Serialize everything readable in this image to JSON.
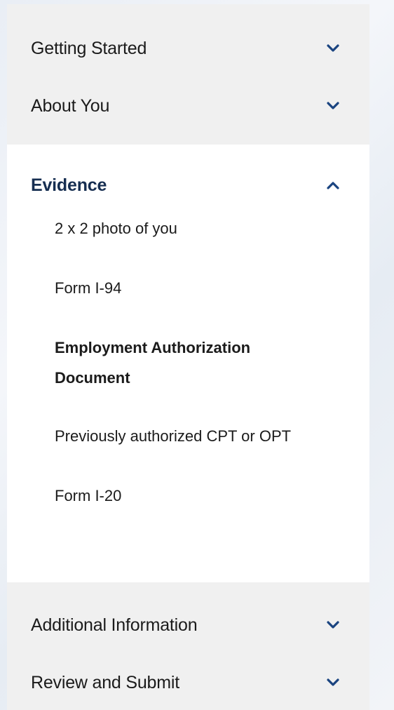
{
  "nav": {
    "sections_top": [
      {
        "label": "Getting Started",
        "icon": "chevron-down-icon"
      },
      {
        "label": "About You",
        "icon": "chevron-down-icon"
      }
    ],
    "evidence": {
      "label": "Evidence",
      "icon": "chevron-up-icon",
      "items": [
        {
          "label": "2 x 2 photo of you"
        },
        {
          "label": "Form I-94"
        },
        {
          "label": "Employment Authorization Document",
          "current": true
        },
        {
          "label": "Previously authorized CPT or OPT"
        },
        {
          "label": "Form I-20"
        }
      ]
    },
    "sections_bottom": [
      {
        "label": "Additional Information",
        "icon": "chevron-down-icon"
      },
      {
        "label": "Review and Submit",
        "icon": "chevron-down-icon"
      }
    ]
  },
  "colors": {
    "chevron": "#1a4480",
    "active_heading": "#162e51",
    "group_background": "#f0f0f0"
  }
}
